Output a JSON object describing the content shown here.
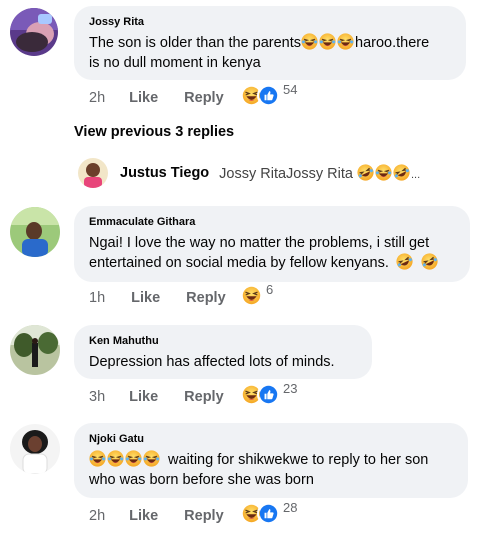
{
  "view_previous": "View previous 3 replies",
  "comments": [
    {
      "author": "Jossy Rita",
      "line1_text": "The son is older than the parents",
      "line1_tail": "haroo.there",
      "line2": "is no dull moment in kenya",
      "time": "2h",
      "like": "Like",
      "reply": "Reply",
      "reaction_count": "54"
    },
    {
      "author": "Emmaculate Githara",
      "line1": "Ngai! I love the way no matter the problems, i still get",
      "line2_text": "entertained on social media by fellow kenyans.",
      "time": "1h",
      "like": "Like",
      "reply": "Reply",
      "reaction_count": "6"
    },
    {
      "author": "Ken Mahuthu",
      "line1": "Depression has affected lots of minds.",
      "time": "3h",
      "like": "Like",
      "reply": "Reply",
      "reaction_count": "23"
    },
    {
      "author": "Njoki Gatu",
      "line1_text": "waiting for shikwekwe to reply to her son",
      "line2": "who was born before she was born",
      "time": "2h",
      "like": "Like",
      "reply": "Reply",
      "reaction_count": "28"
    }
  ],
  "reply_preview": {
    "author": "Justus Tiego",
    "text": "Jossy RitaJossy Rita",
    "ellipsis": "..."
  },
  "colors": {
    "bubble": "#f0f2f5",
    "meta": "#65676b",
    "like_blue": "#1877f2",
    "haha_yellow": "#f7b125"
  },
  "icons": {
    "haha": "laughing-emoji-icon",
    "like": "thumbs-up-icon",
    "rofl": "rolling-laughing-emoji-icon"
  }
}
